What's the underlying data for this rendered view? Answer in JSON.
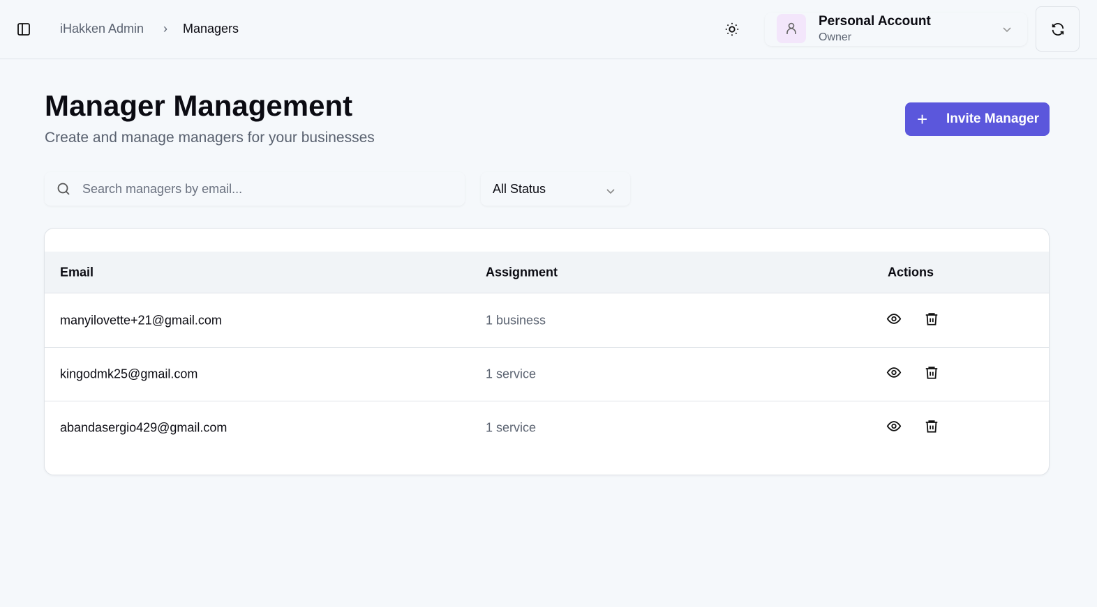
{
  "header": {
    "breadcrumb": [
      "iHakken Admin",
      "Managers"
    ],
    "account": {
      "name": "Personal Account",
      "role": "Owner"
    }
  },
  "page": {
    "title": "Manager Management",
    "subtitle": "Create and manage managers for your businesses",
    "invite_label": "Invite Manager"
  },
  "filters": {
    "search_placeholder": "Search managers by email...",
    "status_value": "All Status"
  },
  "table": {
    "columns": [
      "Email",
      "Assignment",
      "Actions"
    ],
    "rows": [
      {
        "email": "manyilovette+21@gmail.com",
        "assignment": "1 business"
      },
      {
        "email": "kingodmk25@gmail.com",
        "assignment": "1 service"
      },
      {
        "email": "abandasergio429@gmail.com",
        "assignment": "1 service"
      }
    ]
  },
  "colors": {
    "accent": "#5b57dc"
  }
}
